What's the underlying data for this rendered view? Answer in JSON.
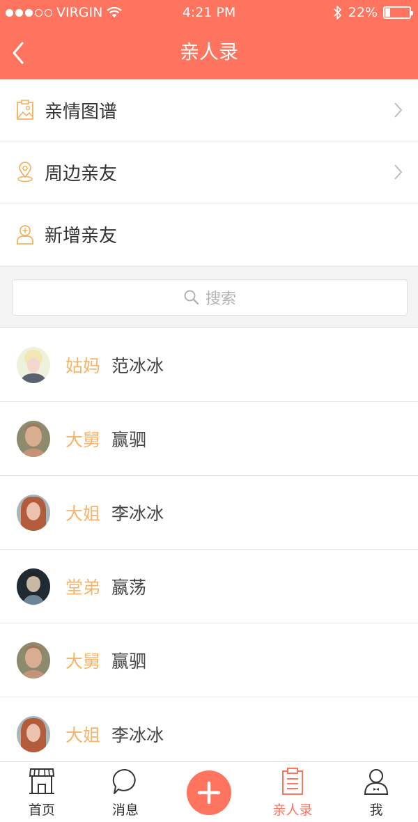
{
  "status_bar": {
    "carrier": "VIRGIN",
    "time": "4:21 PM",
    "battery": "22%",
    "battery_level": 0.22
  },
  "header": {
    "title": "亲人录"
  },
  "menu": [
    {
      "label": "亲情图谱",
      "icon": "image-frame-icon",
      "has_chevron": true
    },
    {
      "label": "周边亲友",
      "icon": "location-pin-icon",
      "has_chevron": true
    },
    {
      "label": "新增亲友",
      "icon": "add-person-icon",
      "has_chevron": false
    }
  ],
  "search": {
    "placeholder": "搜索"
  },
  "contacts": [
    {
      "relation": "姑妈",
      "name": "范冰冰",
      "avatar": "avatar-blonde-woman"
    },
    {
      "relation": "大舅",
      "name": "赢驷",
      "avatar": "avatar-young-man"
    },
    {
      "relation": "大姐",
      "name": "李冰冰",
      "avatar": "avatar-redhead-woman"
    },
    {
      "relation": "堂弟",
      "name": "嬴荡",
      "avatar": "avatar-boy"
    },
    {
      "relation": "大舅",
      "name": "赢驷",
      "avatar": "avatar-young-man"
    },
    {
      "relation": "大姐",
      "name": "李冰冰",
      "avatar": "avatar-redhead-woman"
    }
  ],
  "tabbar": {
    "items": [
      {
        "label": "首页",
        "icon": "storefront-icon",
        "active": false
      },
      {
        "label": "消息",
        "icon": "chat-bubble-icon",
        "active": false
      },
      {
        "label": "",
        "icon": "plus-icon",
        "active": false
      },
      {
        "label": "亲人录",
        "icon": "clipboard-icon",
        "active": true
      },
      {
        "label": "我",
        "icon": "user-icon",
        "active": false
      }
    ]
  },
  "colors": {
    "accent": "#ff745f",
    "relation": "#f7b469",
    "menu_icon": "#f5b15f"
  }
}
